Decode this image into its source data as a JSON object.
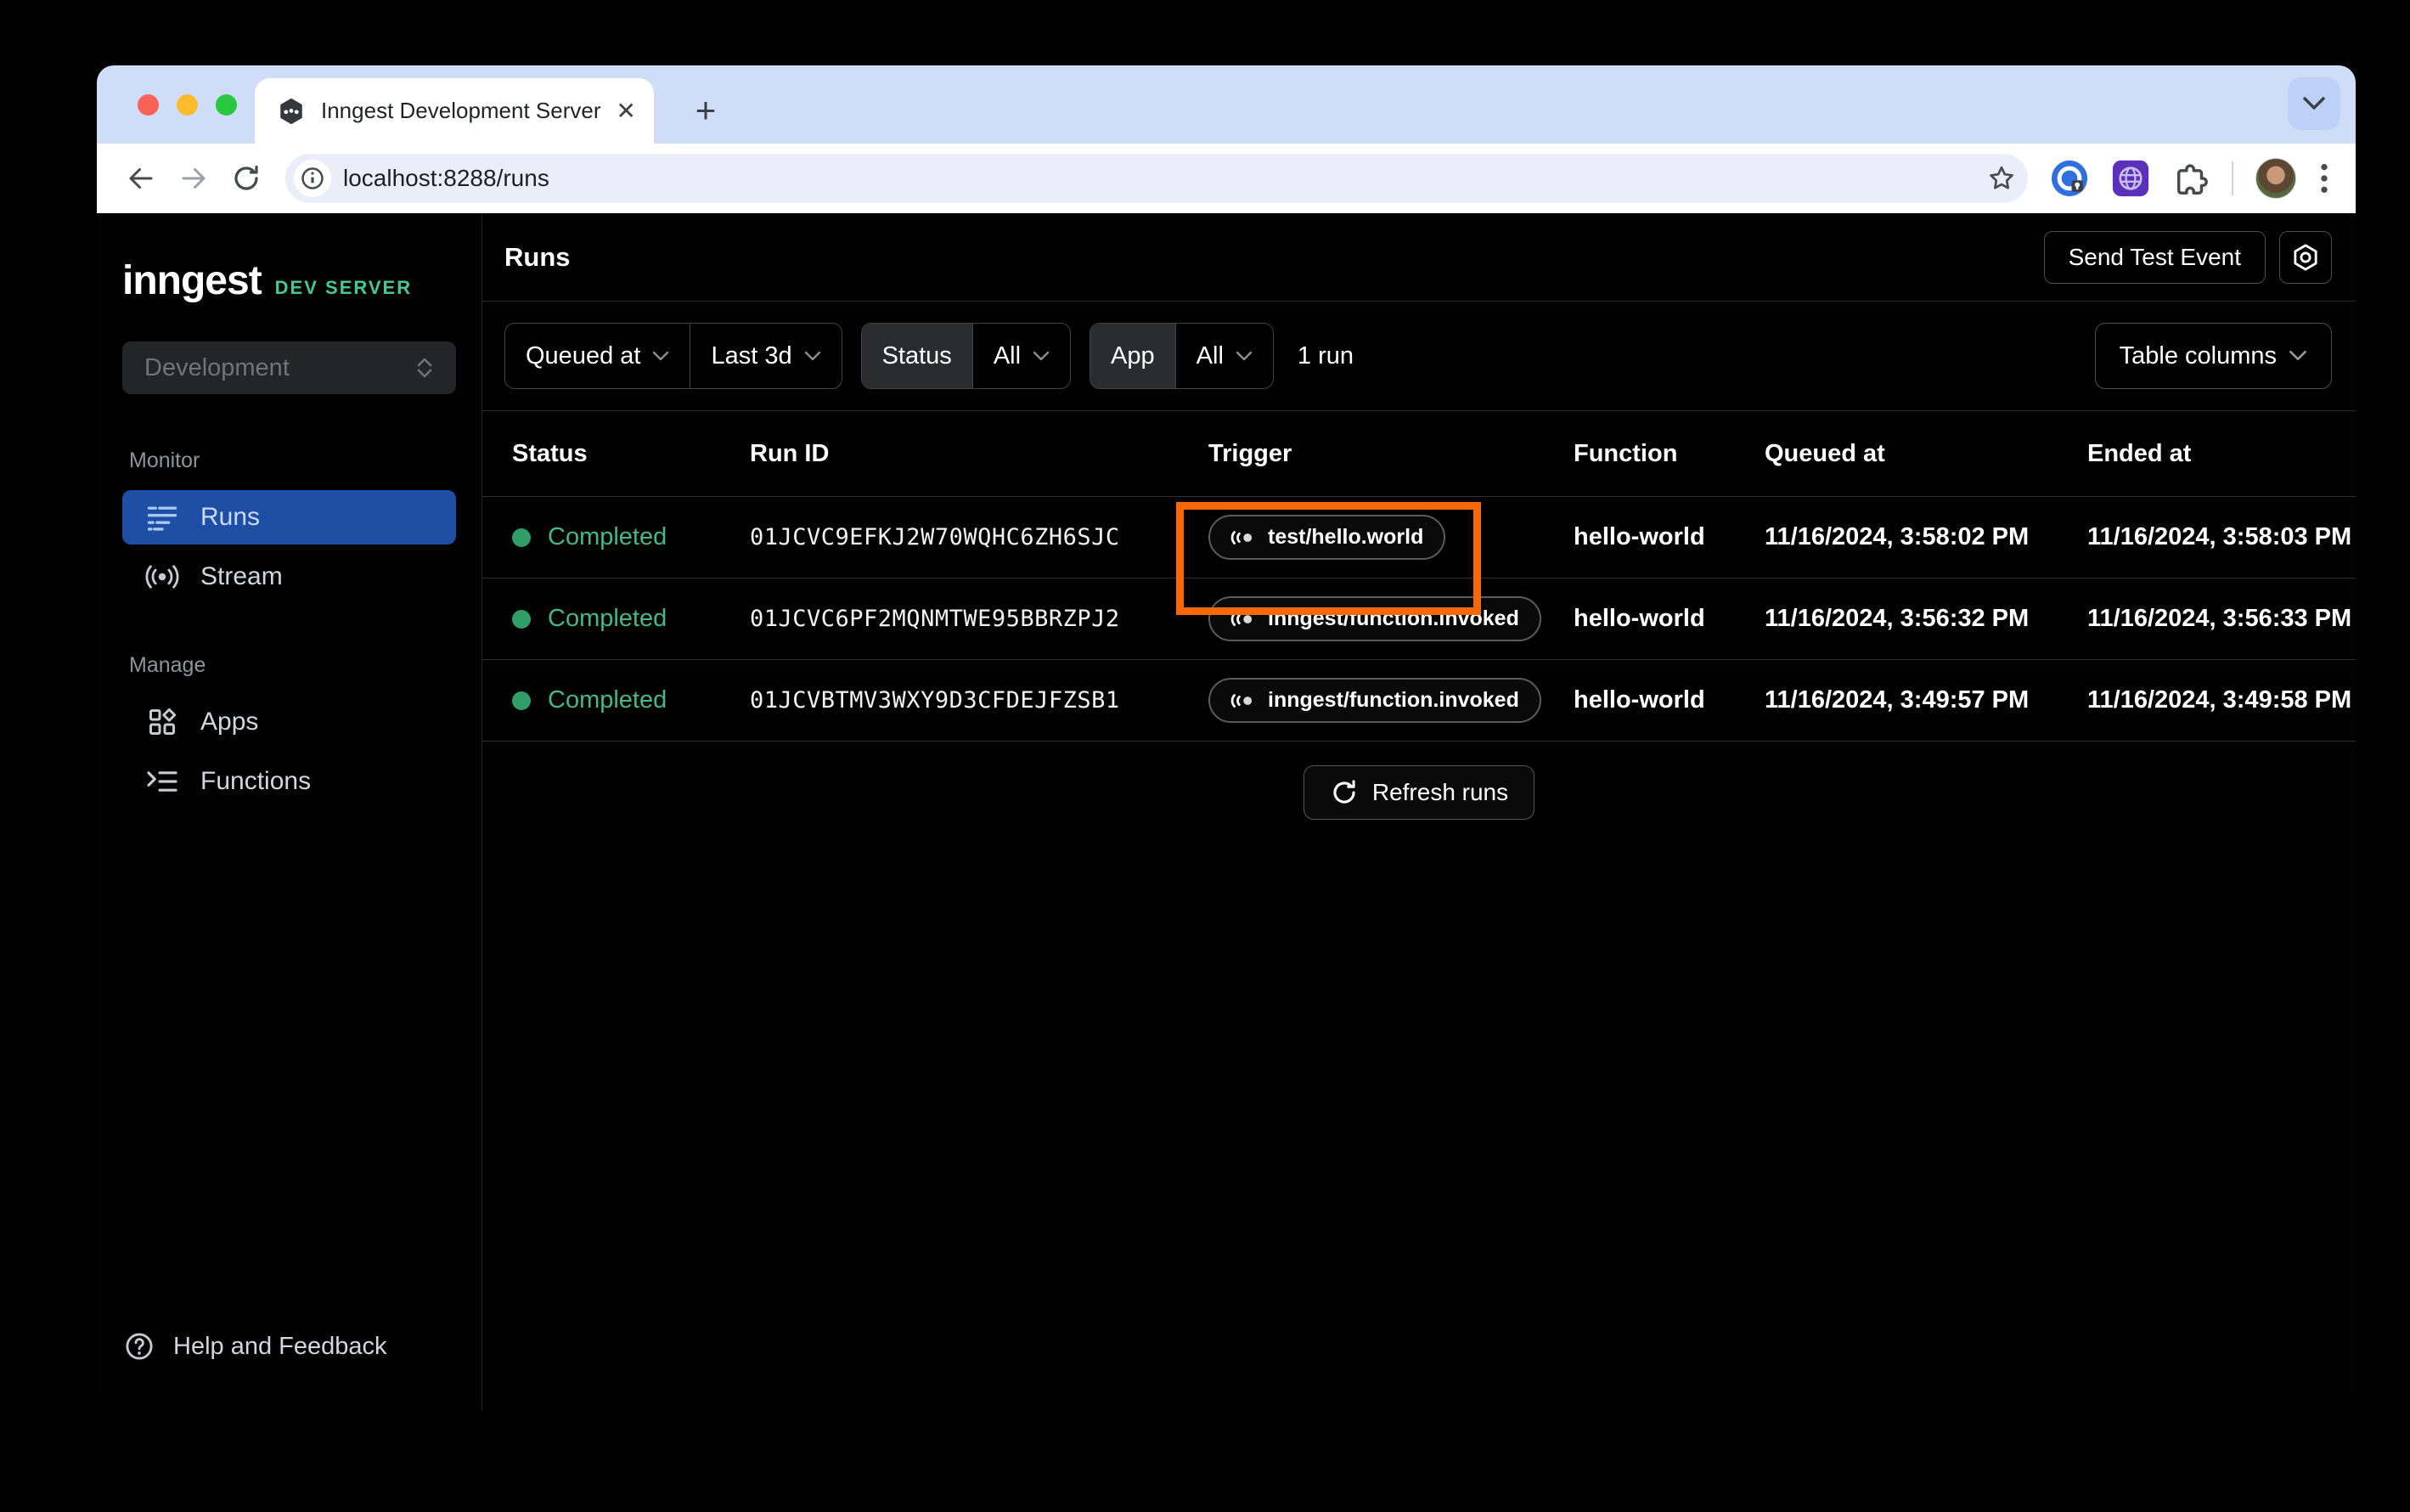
{
  "browser": {
    "tab_title": "Inngest Development Server",
    "new_tab_label": "+",
    "close_label": "✕",
    "url": "localhost:8288/runs"
  },
  "sidebar": {
    "logo": "inngest",
    "env_badge": "DEV SERVER",
    "workspace": "Development",
    "sections": [
      {
        "label": "Monitor",
        "items": [
          {
            "label": "Runs",
            "icon": "runs-list-icon",
            "active": true
          },
          {
            "label": "Stream",
            "icon": "stream-icon",
            "active": false
          }
        ]
      },
      {
        "label": "Manage",
        "items": [
          {
            "label": "Apps",
            "icon": "apps-icon",
            "active": false
          },
          {
            "label": "Functions",
            "icon": "functions-icon",
            "active": false
          }
        ]
      }
    ],
    "footer": {
      "label": "Help and Feedback"
    }
  },
  "header": {
    "title": "Runs",
    "send_test_event_label": "Send Test Event"
  },
  "filters": {
    "queued_at_label": "Queued at",
    "time_range": "Last 3d",
    "status_label": "Status",
    "status_value": "All",
    "app_label": "App",
    "app_value": "All",
    "run_count": "1 run",
    "table_columns_label": "Table columns"
  },
  "table": {
    "columns": [
      "Status",
      "Run ID",
      "Trigger",
      "Function",
      "Queued at",
      "Ended at"
    ],
    "rows": [
      {
        "status": "Completed",
        "run_id": "01JCVC9EFKJ2W70WQHC6ZH6SJC",
        "trigger": "test/hello.world",
        "function": "hello-world",
        "queued_at": "11/16/2024, 3:58:02 PM",
        "ended_at": "11/16/2024, 3:58:03 PM",
        "highlighted": true
      },
      {
        "status": "Completed",
        "run_id": "01JCVC6PF2MQNMTWE95BBRZPJ2",
        "trigger": "inngest/function.invoked",
        "function": "hello-world",
        "queued_at": "11/16/2024, 3:56:32 PM",
        "ended_at": "11/16/2024, 3:56:33 PM",
        "highlighted": false
      },
      {
        "status": "Completed",
        "run_id": "01JCVBTMV3WXY9D3CFDEJFZSB1",
        "trigger": "inngest/function.invoked",
        "function": "hello-world",
        "queued_at": "11/16/2024, 3:49:57 PM",
        "ended_at": "11/16/2024, 3:49:58 PM",
        "highlighted": false
      }
    ],
    "refresh_label": "Refresh runs"
  },
  "colors": {
    "accent_blue": "#1e4fa5",
    "status_green": "#44b888",
    "env_green": "#45c993",
    "highlight_orange": "#f76808"
  }
}
